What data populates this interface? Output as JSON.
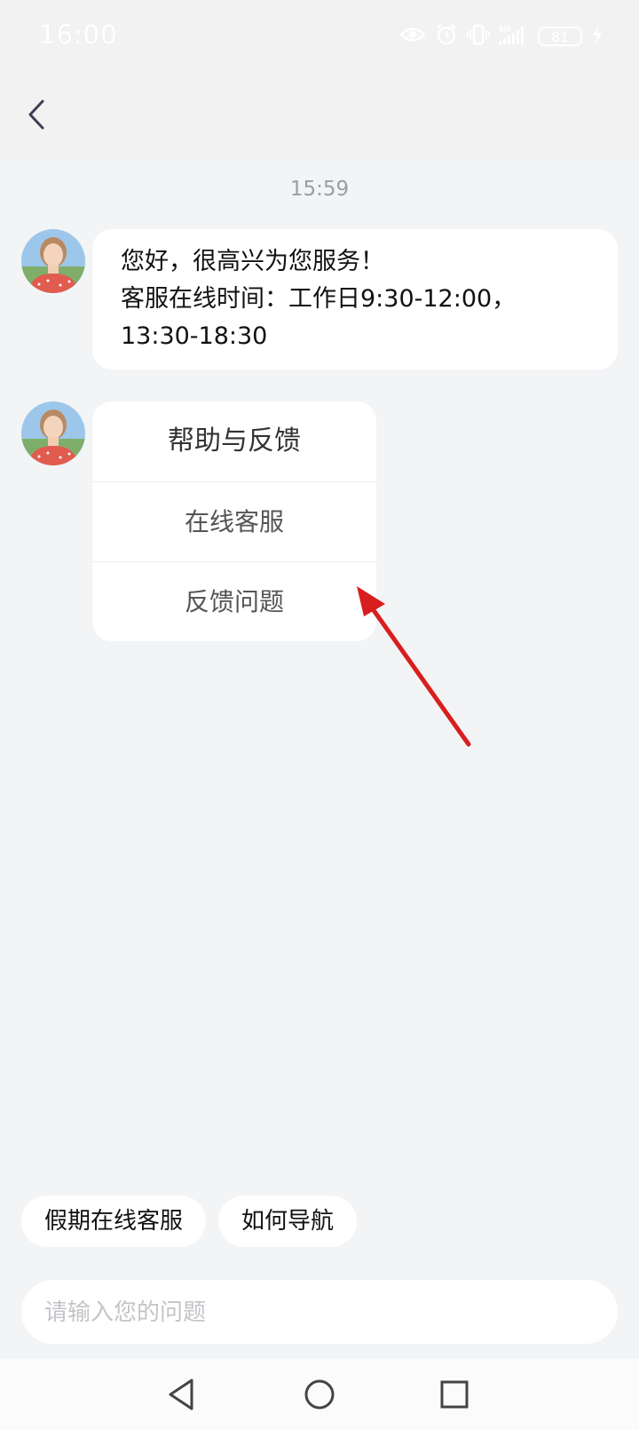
{
  "status_bar": {
    "time": "16:00",
    "battery": "81",
    "network": "5G",
    "icons": [
      "eye-icon",
      "alarm-icon",
      "vibrate-icon",
      "signal-5g-icon",
      "battery-icon",
      "charging-icon"
    ]
  },
  "chat": {
    "timestamp": "15:59",
    "greeting": {
      "lines": [
        "您好，很高兴为您服务！",
        "客服在线时间：工作日9:30-12:00，",
        "13:30-18:30"
      ]
    },
    "card": {
      "title": "帮助与反馈",
      "options": [
        "在线客服",
        "反馈问题"
      ]
    }
  },
  "quick_replies": [
    "假期在线客服",
    "如何导航"
  ],
  "input": {
    "placeholder": "请输入您的问题",
    "value": ""
  },
  "colors": {
    "background": "#f3f4f6",
    "bubble": "#ffffff",
    "annotation_arrow": "#d81e1e"
  }
}
